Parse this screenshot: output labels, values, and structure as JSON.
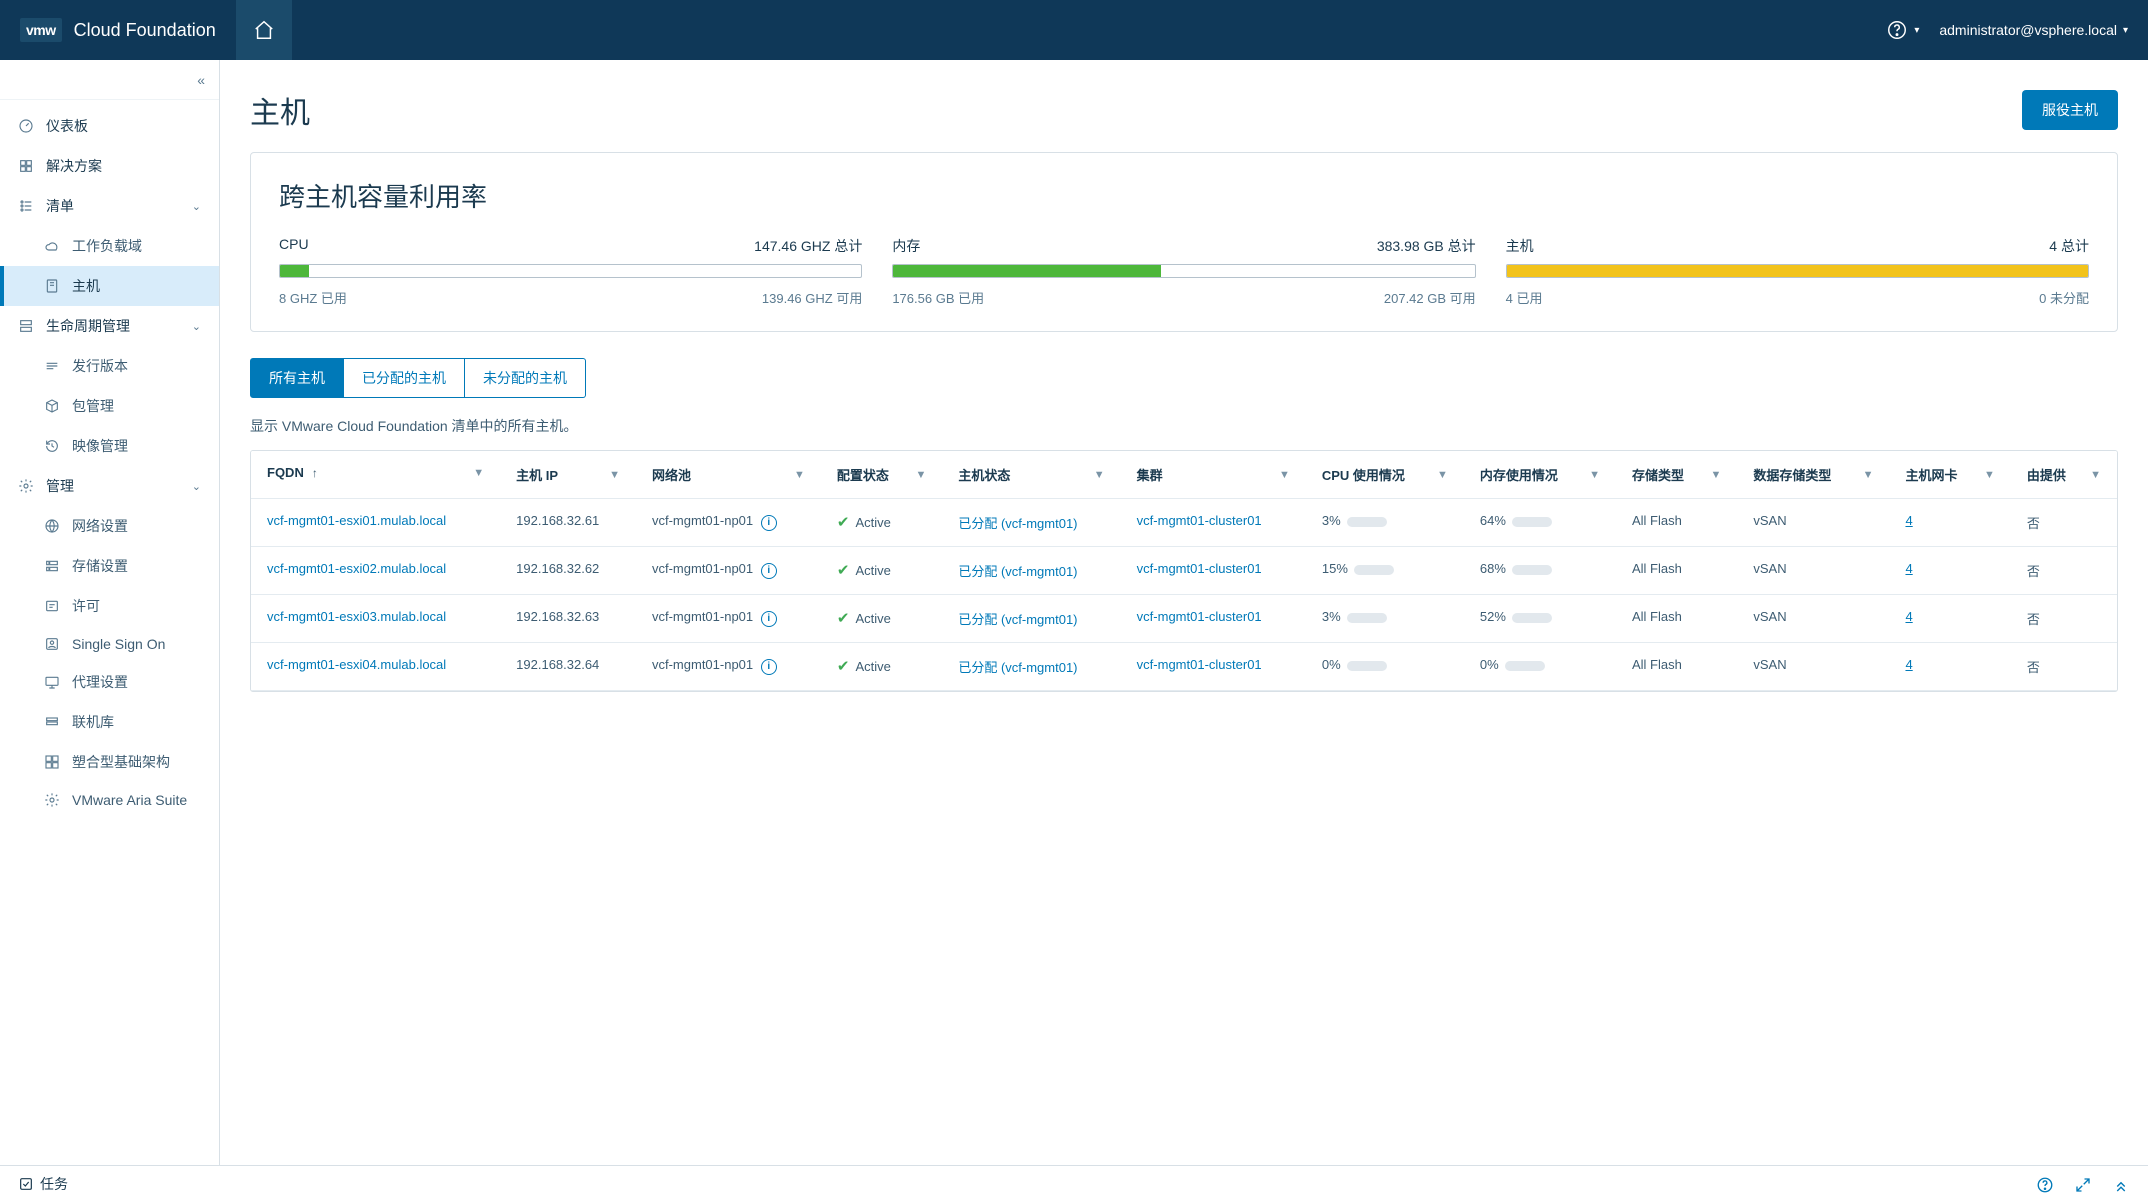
{
  "header": {
    "brand_short": "vmw",
    "brand_title": "Cloud Foundation",
    "user": "administrator@vsphere.local"
  },
  "sidebar": {
    "collapse_aria": "«",
    "items": [
      {
        "icon": "gauge",
        "label": "仪表板",
        "type": "section"
      },
      {
        "icon": "grid",
        "label": "解决方案",
        "type": "section"
      },
      {
        "icon": "list",
        "label": "清单",
        "type": "section",
        "caret": true
      },
      {
        "icon": "cloud",
        "label": "工作负载域",
        "type": "sub"
      },
      {
        "icon": "host",
        "label": "主机",
        "type": "sub",
        "active": true
      },
      {
        "icon": "layers",
        "label": "生命周期管理",
        "type": "section",
        "caret": true
      },
      {
        "icon": "release",
        "label": "发行版本",
        "type": "sub"
      },
      {
        "icon": "package",
        "label": "包管理",
        "type": "sub"
      },
      {
        "icon": "history",
        "label": "映像管理",
        "type": "sub"
      },
      {
        "icon": "cog",
        "label": "管理",
        "type": "section",
        "caret": true
      },
      {
        "icon": "network",
        "label": "网络设置",
        "type": "sub"
      },
      {
        "icon": "storage",
        "label": "存储设置",
        "type": "sub"
      },
      {
        "icon": "license",
        "label": "许可",
        "type": "sub"
      },
      {
        "icon": "sso",
        "label": "Single Sign On",
        "type": "sub"
      },
      {
        "icon": "proxy",
        "label": "代理设置",
        "type": "sub"
      },
      {
        "icon": "depot",
        "label": "联机库",
        "type": "sub"
      },
      {
        "icon": "composable",
        "label": "塑合型基础架构",
        "type": "sub"
      },
      {
        "icon": "aria",
        "label": "VMware Aria Suite",
        "type": "sub"
      }
    ]
  },
  "page": {
    "title": "主机",
    "action_button": "服役主机",
    "capacity_title": "跨主机容量利用率",
    "tabs": [
      "所有主机",
      "已分配的主机",
      "未分配的主机"
    ],
    "active_tab": 0,
    "tab_description": "显示 VMware Cloud Foundation 清单中的所有主机。",
    "task_label": "任务"
  },
  "capacity": {
    "cpu": {
      "label": "CPU",
      "total": "147.46 GHZ 总计",
      "used": "8 GHZ 已用",
      "free": "139.46 GHZ 可用",
      "pct": 5,
      "color": "#4db73a"
    },
    "memory": {
      "label": "内存",
      "total": "383.98 GB 总计",
      "used": "176.56 GB 已用",
      "free": "207.42 GB 可用",
      "pct": 46,
      "color": "#4db73a"
    },
    "hosts": {
      "label": "主机",
      "total": "4 总计",
      "used": "4 已用",
      "free": "0 未分配",
      "pct": 100,
      "color": "#f2c31b"
    }
  },
  "table": {
    "columns": [
      "FQDN",
      "主机 IP",
      "网络池",
      "配置状态",
      "主机状态",
      "集群",
      "CPU 使用情况",
      "内存使用情况",
      "存储类型",
      "数据存储类型",
      "主机网卡",
      "由提供"
    ],
    "rows": [
      {
        "fqdn": "vcf-mgmt01-esxi01.mulab.local",
        "ip": "192.168.32.61",
        "pool": "vcf-mgmt01-np01",
        "config": "Active",
        "host_state": "已分配 (vcf-mgmt01)",
        "cluster": "vcf-mgmt01-cluster01",
        "cpu_pct": "3%",
        "cpu_bar": 3,
        "mem_pct": "64%",
        "mem_bar": 64,
        "storage": "All Flash",
        "datastore": "vSAN",
        "nics": "4",
        "provided": "否"
      },
      {
        "fqdn": "vcf-mgmt01-esxi02.mulab.local",
        "ip": "192.168.32.62",
        "pool": "vcf-mgmt01-np01",
        "config": "Active",
        "host_state": "已分配 (vcf-mgmt01)",
        "cluster": "vcf-mgmt01-cluster01",
        "cpu_pct": "15%",
        "cpu_bar": 15,
        "mem_pct": "68%",
        "mem_bar": 68,
        "storage": "All Flash",
        "datastore": "vSAN",
        "nics": "4",
        "provided": "否"
      },
      {
        "fqdn": "vcf-mgmt01-esxi03.mulab.local",
        "ip": "192.168.32.63",
        "pool": "vcf-mgmt01-np01",
        "config": "Active",
        "host_state": "已分配 (vcf-mgmt01)",
        "cluster": "vcf-mgmt01-cluster01",
        "cpu_pct": "3%",
        "cpu_bar": 3,
        "mem_pct": "52%",
        "mem_bar": 52,
        "storage": "All Flash",
        "datastore": "vSAN",
        "nics": "4",
        "provided": "否"
      },
      {
        "fqdn": "vcf-mgmt01-esxi04.mulab.local",
        "ip": "192.168.32.64",
        "pool": "vcf-mgmt01-np01",
        "config": "Active",
        "host_state": "已分配 (vcf-mgmt01)",
        "cluster": "vcf-mgmt01-cluster01",
        "cpu_pct": "0%",
        "cpu_bar": 0,
        "mem_pct": "0%",
        "mem_bar": 0,
        "storage": "All Flash",
        "datastore": "vSAN",
        "nics": "4",
        "provided": "否"
      }
    ]
  }
}
